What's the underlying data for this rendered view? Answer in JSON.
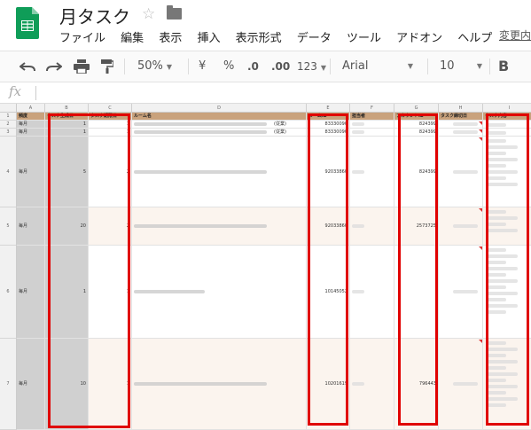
{
  "app": {
    "title": "月タスク",
    "change_link": "変更内",
    "menu": [
      "ファイル",
      "編集",
      "表示",
      "挿入",
      "表示形式",
      "データ",
      "ツール",
      "アドオン",
      "ヘルプ"
    ]
  },
  "toolbar": {
    "zoom": "50%",
    "currency": "¥",
    "percent": "%",
    "decrease_decimal": ".0",
    "increase_decimal": ".00",
    "more_formats": "123",
    "font": "Arial",
    "font_size": "10",
    "bold": "B"
  },
  "formula_bar": {
    "fx": "fx",
    "value": ""
  },
  "columns": [
    "A",
    "B",
    "C",
    "D",
    "E",
    "F",
    "G",
    "H",
    "I"
  ],
  "headers": {
    "A": "頻度",
    "B": "タスク生成日",
    "C": "タスク期限日",
    "D": "ルーム名",
    "E": "ルームID",
    "F": "担当者",
    "G": "アカウントID",
    "H": "タスク締切日",
    "I": "タスク内容"
  },
  "rows": [
    {
      "num": "2",
      "A": "毎月",
      "B": "1",
      "C": "1",
      "D_suffix": "(従業)",
      "E": "83330090",
      "G": "824399"
    },
    {
      "num": "3",
      "A": "毎月",
      "B": "1",
      "C": "1",
      "D_suffix": "(従業)",
      "E": "83330090",
      "G": "824399"
    },
    {
      "num": "4",
      "A": "毎月",
      "B": "5",
      "C": "2",
      "D_suffix": "",
      "E": "92033860",
      "G": "824399"
    },
    {
      "num": "5",
      "A": "毎月",
      "B": "20",
      "C": "2",
      "D_suffix": "",
      "E": "92033860",
      "G": "2573725"
    },
    {
      "num": "6",
      "A": "毎月",
      "B": "1",
      "C": "1",
      "D_suffix": "",
      "E": "10145052",
      "G": ""
    },
    {
      "num": "7",
      "A": "毎月",
      "B": "10",
      "C": "1",
      "D_suffix": "",
      "E": "10201619",
      "G": "796443"
    }
  ],
  "colors": {
    "header_row": "#c9a27c",
    "highlight_box": "#e00000",
    "sheets_green": "#0f9d58"
  },
  "icons": [
    "sheets-logo-icon",
    "star-icon",
    "folder-icon",
    "undo-icon",
    "redo-icon",
    "print-icon",
    "paint-format-icon"
  ]
}
